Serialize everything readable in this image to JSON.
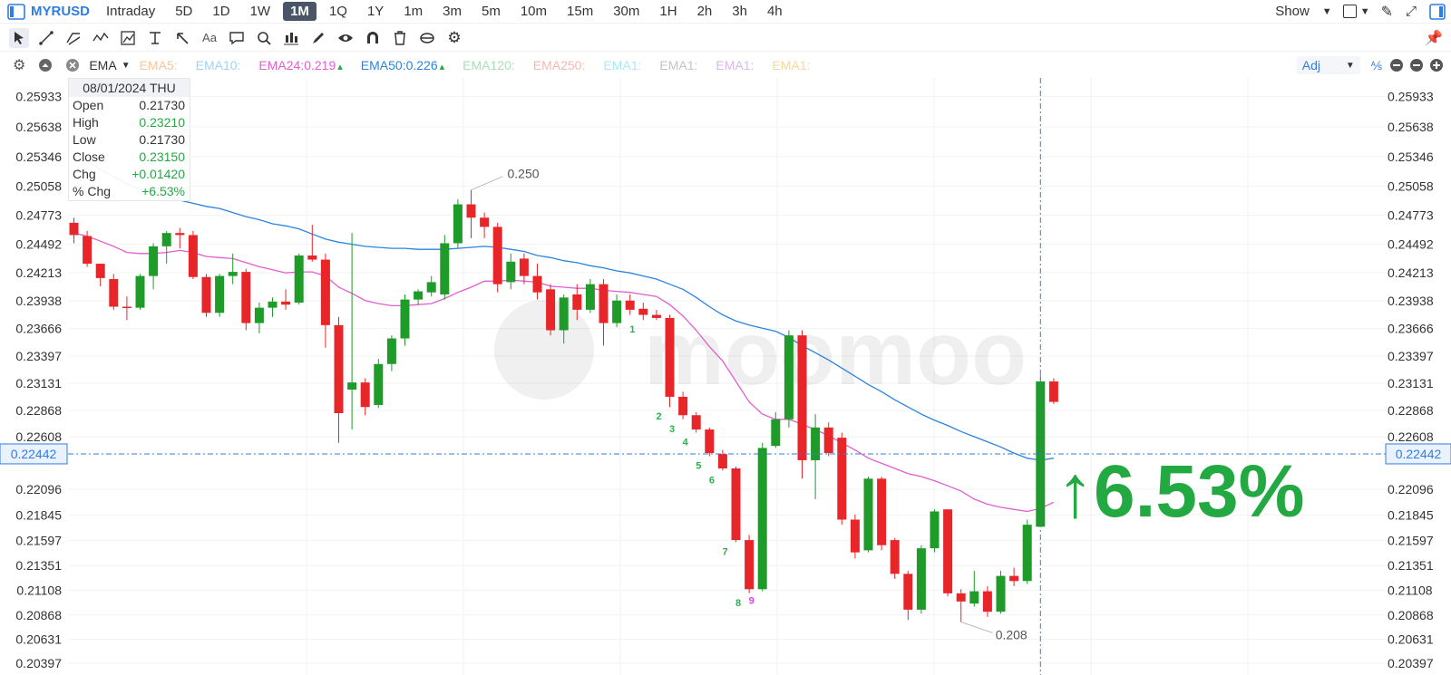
{
  "topbar": {
    "ticker": "MYRUSD",
    "intraday_label": "Intraday",
    "timeframes": [
      "5D",
      "1D",
      "1W",
      "1M",
      "1Q",
      "1Y",
      "1m",
      "3m",
      "5m",
      "10m",
      "15m",
      "30m",
      "1H",
      "2h",
      "3h",
      "4h"
    ],
    "active_timeframe": "1M",
    "show_label": "Show"
  },
  "toolbar": {
    "tools": [
      "cursor-icon",
      "line-icon",
      "channel-icon",
      "wave-icon",
      "measure-icon",
      "vertical-line-icon",
      "arrow-icon",
      "text-icon",
      "comment-icon",
      "zoom-icon",
      "chart-type-icon",
      "brush-icon",
      "eye-icon",
      "magnet-icon",
      "trash-icon",
      "sync-icon",
      "settings-icon"
    ],
    "text_tool_label": "Aa"
  },
  "indicators": {
    "selected": "EMA",
    "items": [
      {
        "label": "EMA5:",
        "color": "#f7c79a"
      },
      {
        "label": "EMA10:",
        "color": "#9fd3f0"
      },
      {
        "label": "EMA24:0.219",
        "color": "#e25ecf",
        "arrow": "up"
      },
      {
        "label": "EMA50:0.226",
        "color": "#2a83e0",
        "arrow": "up"
      },
      {
        "label": "EMA120:",
        "color": "#a7e0b3"
      },
      {
        "label": "EMA250:",
        "color": "#f6b7b0"
      },
      {
        "label": "EMA1:",
        "color": "#a9e9f5"
      },
      {
        "label": "EMA1:",
        "color": "#c4c4c4"
      },
      {
        "label": "EMA1:",
        "color": "#d7b7f0"
      },
      {
        "label": "EMA1:",
        "color": "#f7d8a0"
      }
    ],
    "adj_label": "Adj"
  },
  "ohlc_box": {
    "date": "08/01/2024 THU",
    "rows": [
      {
        "label": "Open",
        "value": "0.21730"
      },
      {
        "label": "High",
        "value": "0.23210"
      },
      {
        "label": "Low",
        "value": "0.21730"
      },
      {
        "label": "Close",
        "value": "0.23150"
      },
      {
        "label": "Chg",
        "value": "+0.01420"
      },
      {
        "label": "% Chg",
        "value": "+6.53%"
      }
    ]
  },
  "colors": {
    "up": "#1f9b2a",
    "down": "#e8262a",
    "ema24": "#e25ecf",
    "ema50": "#2a83e0",
    "crosshair": "#2f7de1",
    "big_change": "#23a942"
  },
  "watermark": "moomoo",
  "chart_data": {
    "type": "candlestick",
    "ylim": [
      0.20397,
      0.26
    ],
    "yticks": [
      "0.25933",
      "0.25638",
      "0.25346",
      "0.25058",
      "0.24773",
      "0.24492",
      "0.24213",
      "0.23938",
      "0.23666",
      "0.23397",
      "0.23131",
      "0.22868",
      "0.22608",
      "0.22442",
      "0.22096",
      "0.21845",
      "0.21597",
      "0.21351",
      "0.21108",
      "0.20868",
      "0.20631",
      "0.20397"
    ],
    "crosshair_price": "0.22442",
    "high_label": "0.250",
    "low_label": "0.208",
    "big_change_label": "↑6.53%",
    "candles": [
      [
        0.247,
        0.2475,
        0.245,
        0.2458
      ],
      [
        0.2457,
        0.2462,
        0.2427,
        0.243
      ],
      [
        0.243,
        0.243,
        0.2408,
        0.2416
      ],
      [
        0.2415,
        0.242,
        0.2385,
        0.2388
      ],
      [
        0.2388,
        0.2398,
        0.2375,
        0.2387
      ],
      [
        0.2387,
        0.242,
        0.2385,
        0.2418
      ],
      [
        0.2418,
        0.245,
        0.2405,
        0.2447
      ],
      [
        0.2447,
        0.2462,
        0.243,
        0.246
      ],
      [
        0.246,
        0.2465,
        0.2445,
        0.2458
      ],
      [
        0.2458,
        0.2462,
        0.2415,
        0.2417
      ],
      [
        0.2417,
        0.242,
        0.2378,
        0.2382
      ],
      [
        0.2382,
        0.242,
        0.2378,
        0.2418
      ],
      [
        0.2418,
        0.244,
        0.241,
        0.2422
      ],
      [
        0.2422,
        0.2425,
        0.2365,
        0.2372
      ],
      [
        0.2372,
        0.2392,
        0.2362,
        0.2387
      ],
      [
        0.2387,
        0.2397,
        0.2378,
        0.2393
      ],
      [
        0.2393,
        0.2405,
        0.2385,
        0.239
      ],
      [
        0.2392,
        0.244,
        0.239,
        0.2438
      ],
      [
        0.2438,
        0.2468,
        0.2432,
        0.2434
      ],
      [
        0.2434,
        0.244,
        0.2348,
        0.237
      ],
      [
        0.237,
        0.2378,
        0.2255,
        0.2284
      ],
      [
        0.2307,
        0.246,
        0.2268,
        0.2314
      ],
      [
        0.2314,
        0.2318,
        0.2282,
        0.229
      ],
      [
        0.2292,
        0.2337,
        0.2289,
        0.2332
      ],
      [
        0.2332,
        0.236,
        0.2325,
        0.2357
      ],
      [
        0.2357,
        0.24,
        0.235,
        0.2395
      ],
      [
        0.2395,
        0.2405,
        0.239,
        0.2403
      ],
      [
        0.2402,
        0.2418,
        0.2398,
        0.2412
      ],
      [
        0.24,
        0.2458,
        0.2395,
        0.245
      ],
      [
        0.245,
        0.2493,
        0.2445,
        0.2488
      ],
      [
        0.2488,
        0.2502,
        0.2455,
        0.2475
      ],
      [
        0.2475,
        0.248,
        0.2455,
        0.2466
      ],
      [
        0.2466,
        0.247,
        0.2402,
        0.241
      ],
      [
        0.2412,
        0.244,
        0.2405,
        0.2432
      ],
      [
        0.2435,
        0.244,
        0.241,
        0.2418
      ],
      [
        0.2418,
        0.243,
        0.2395,
        0.2402
      ],
      [
        0.2405,
        0.241,
        0.236,
        0.2365
      ],
      [
        0.2365,
        0.24,
        0.2352,
        0.2397
      ],
      [
        0.24,
        0.241,
        0.2375,
        0.2385
      ],
      [
        0.2385,
        0.2415,
        0.2382,
        0.241
      ],
      [
        0.241,
        0.2415,
        0.235,
        0.2372
      ],
      [
        0.2372,
        0.24,
        0.2368,
        0.2394
      ],
      [
        0.2394,
        0.24,
        0.238,
        0.2385
      ],
      [
        0.2386,
        0.2392,
        0.2375,
        0.238
      ],
      [
        0.238,
        0.2385,
        0.2375,
        0.2377
      ],
      [
        0.2377,
        0.238,
        0.229,
        0.23
      ],
      [
        0.23,
        0.2305,
        0.2278,
        0.2282
      ],
      [
        0.2282,
        0.2285,
        0.2265,
        0.2268
      ],
      [
        0.2268,
        0.227,
        0.2242,
        0.2245
      ],
      [
        0.2244,
        0.2248,
        0.2228,
        0.223
      ],
      [
        0.223,
        0.2232,
        0.2158,
        0.216
      ],
      [
        0.216,
        0.2165,
        0.2108,
        0.2112
      ],
      [
        0.2112,
        0.2255,
        0.211,
        0.225
      ],
      [
        0.2252,
        0.2285,
        0.225,
        0.2278
      ],
      [
        0.2278,
        0.2365,
        0.227,
        0.236
      ],
      [
        0.236,
        0.2365,
        0.222,
        0.2238
      ],
      [
        0.2238,
        0.2283,
        0.22,
        0.227
      ],
      [
        0.227,
        0.2275,
        0.2242,
        0.2245
      ],
      [
        0.226,
        0.2265,
        0.2175,
        0.218
      ],
      [
        0.218,
        0.2185,
        0.2142,
        0.2148
      ],
      [
        0.215,
        0.2222,
        0.2148,
        0.222
      ],
      [
        0.222,
        0.2222,
        0.215,
        0.2155
      ],
      [
        0.216,
        0.2162,
        0.2122,
        0.2127
      ],
      [
        0.2127,
        0.213,
        0.2082,
        0.2092
      ],
      [
        0.2092,
        0.2155,
        0.2088,
        0.2152
      ],
      [
        0.2152,
        0.219,
        0.2148,
        0.2188
      ],
      [
        0.219,
        0.219,
        0.2105,
        0.2108
      ],
      [
        0.2108,
        0.2112,
        0.208,
        0.21
      ],
      [
        0.2098,
        0.213,
        0.2095,
        0.211
      ],
      [
        0.211,
        0.2115,
        0.2085,
        0.209
      ],
      [
        0.209,
        0.213,
        0.2088,
        0.2125
      ],
      [
        0.2125,
        0.2133,
        0.2115,
        0.212
      ],
      [
        0.212,
        0.218,
        0.2117,
        0.2175
      ],
      [
        0.2173,
        0.2321,
        0.2173,
        0.2315
      ],
      [
        0.2315,
        0.2318,
        0.2293,
        0.2295
      ]
    ],
    "ema24": [
      0.246,
      0.2457,
      0.2452,
      0.2447,
      0.2441,
      0.244,
      0.244,
      0.2441,
      0.2443,
      0.2441,
      0.2437,
      0.2436,
      0.2435,
      0.2431,
      0.2427,
      0.2424,
      0.2421,
      0.2422,
      0.2422,
      0.2418,
      0.2407,
      0.2401,
      0.2394,
      0.2391,
      0.2389,
      0.2389,
      0.239,
      0.2391,
      0.2396,
      0.2402,
      0.2407,
      0.2413,
      0.2413,
      0.2414,
      0.2413,
      0.2412,
      0.2408,
      0.2407,
      0.2406,
      0.2406,
      0.2404,
      0.2403,
      0.2402,
      0.24,
      0.2398,
      0.239,
      0.2379,
      0.2365,
      0.2349,
      0.2335,
      0.2315,
      0.2295,
      0.2283,
      0.2278,
      0.2278,
      0.2273,
      0.2268,
      0.2262,
      0.2255,
      0.2248,
      0.224,
      0.2235,
      0.223,
      0.2225,
      0.2222,
      0.2218,
      0.2213,
      0.2208,
      0.22,
      0.2195,
      0.2192,
      0.219,
      0.2188,
      0.2191,
      0.2197
    ],
    "ema50": [
      0.254,
      0.253,
      0.2522,
      0.2515,
      0.2508,
      0.2503,
      0.2499,
      0.2495,
      0.2492,
      0.2489,
      0.2486,
      0.2484,
      0.248,
      0.2476,
      0.2473,
      0.2469,
      0.2467,
      0.2464,
      0.2459,
      0.2454,
      0.2451,
      0.2449,
      0.2447,
      0.2446,
      0.2445,
      0.2445,
      0.2444,
      0.2444,
      0.2444,
      0.2445,
      0.2446,
      0.2447,
      0.2446,
      0.2444,
      0.2442,
      0.2438,
      0.2436,
      0.2433,
      0.2431,
      0.2428,
      0.2426,
      0.2423,
      0.2421,
      0.2418,
      0.2415,
      0.241,
      0.2405,
      0.2397,
      0.2388,
      0.238,
      0.2374,
      0.237,
      0.2367,
      0.2364,
      0.2358,
      0.235,
      0.2343,
      0.2336,
      0.2328,
      0.232,
      0.2312,
      0.2305,
      0.2297,
      0.229,
      0.2283,
      0.2277,
      0.2272,
      0.2266,
      0.2261,
      0.2256,
      0.2251,
      0.2245,
      0.224,
      0.2238,
      0.224
    ],
    "sequence_labels": [
      {
        "index": 43,
        "text": "1",
        "color": "#2bb24c"
      },
      {
        "index": 45,
        "text": "2",
        "color": "#2bb24c"
      },
      {
        "index": 46,
        "text": "3",
        "color": "#2bb24c"
      },
      {
        "index": 47,
        "text": "4",
        "color": "#2bb24c"
      },
      {
        "index": 48,
        "text": "5",
        "color": "#2bb24c"
      },
      {
        "index": 49,
        "text": "6",
        "color": "#2bb24c"
      },
      {
        "index": 50,
        "text": "7",
        "color": "#2bb24c"
      },
      {
        "index": 51,
        "text": "8",
        "color": "#2bb24c"
      },
      {
        "index": 52,
        "text": "9",
        "color": "#e040e0"
      }
    ]
  }
}
